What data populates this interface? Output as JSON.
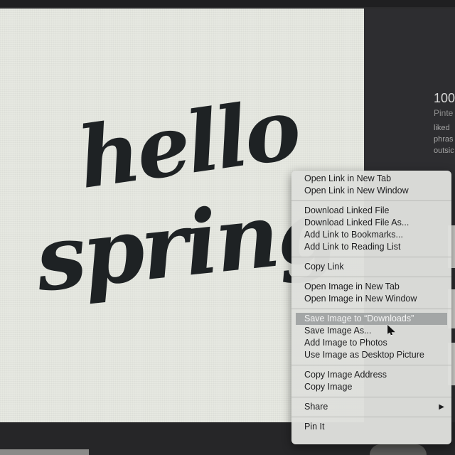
{
  "artwork": {
    "line1": "hello",
    "line2": "spring"
  },
  "pin_info": {
    "save_count": "100",
    "source": "Pinte",
    "description_lines": [
      "liked",
      "phras",
      "outsic"
    ]
  },
  "context_menu": {
    "groups": [
      [
        "Open Link in New Tab",
        "Open Link in New Window"
      ],
      [
        "Download Linked File",
        "Download Linked File As...",
        "Add Link to Bookmarks...",
        "Add Link to Reading List"
      ],
      [
        "Copy Link"
      ],
      [
        "Open Image in New Tab",
        "Open Image in New Window"
      ],
      [
        "Save Image to “Downloads”",
        "Save Image As...",
        "Add Image to Photos",
        "Use Image as Desktop Picture"
      ],
      [
        "Copy Image Address",
        "Copy Image"
      ],
      [
        "Share"
      ],
      [
        "Pin It"
      ]
    ],
    "highlighted_item": "Save Image to “Downloads”",
    "submenu_arrow": "▶"
  }
}
